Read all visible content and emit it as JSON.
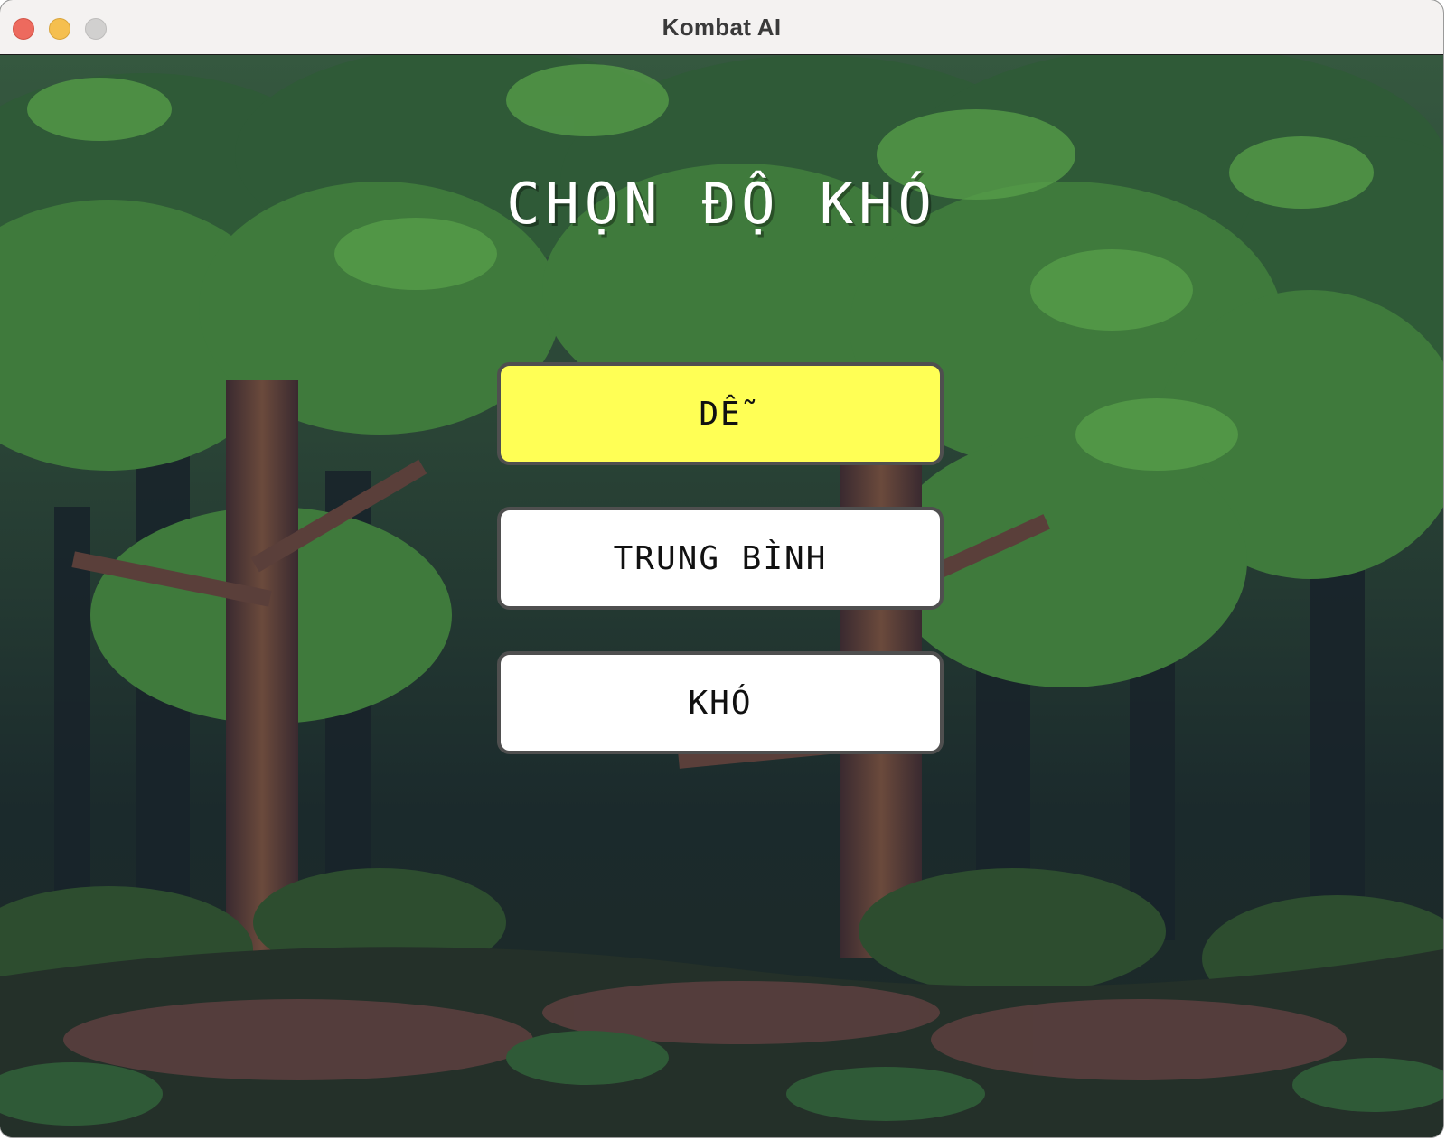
{
  "window": {
    "title": "Kombat AI"
  },
  "menu": {
    "heading": "CHỌN ĐỘ KHÓ",
    "options": [
      {
        "label": "DỄ",
        "selected": true
      },
      {
        "label": "TRUNG BÌNH",
        "selected": false
      },
      {
        "label": "KHÓ",
        "selected": false
      }
    ]
  },
  "colors": {
    "selected_button": "#ffff55",
    "button": "#ffffff",
    "button_border": "#4f4f4f",
    "forest_dark": "#1b2a2c",
    "foliage": "#3f7a3c"
  },
  "icons": {
    "close": "close-icon",
    "minimize": "minimize-icon",
    "maximize": "maximize-icon"
  }
}
